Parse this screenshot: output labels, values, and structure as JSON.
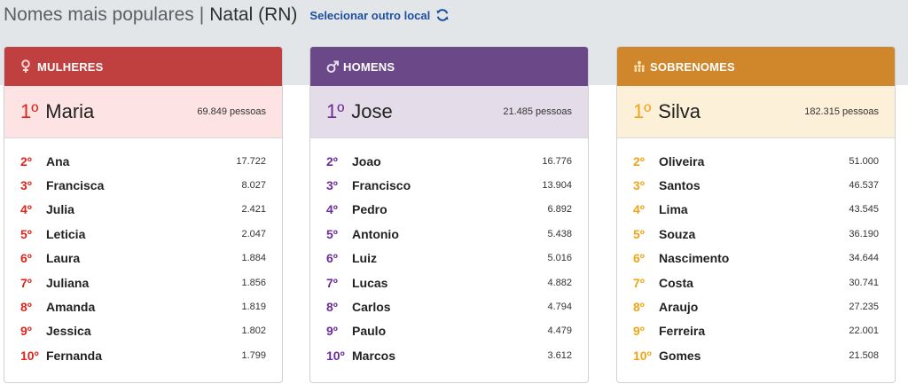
{
  "header": {
    "prefix": "Nomes mais populares",
    "separator": "|",
    "city": "Natal (RN)",
    "change_location_label": "Selecionar outro local",
    "refresh_icon": "refresh-icon"
  },
  "colors": {
    "women": "#c0403f",
    "women_top_bg": "#fde3e4",
    "women_rank": "#e0251a",
    "men": "#6b4887",
    "men_top_bg": "#e4dde9",
    "men_rank": "#6c2c9c",
    "surnames": "#d0862a",
    "surnames_top_bg": "#fdf0d8",
    "surnames_rank": "#f0a416"
  },
  "women": {
    "title": "MULHERES",
    "icon": "female-icon",
    "top": {
      "rank": "1º",
      "name": "Maria",
      "count": "69.849 pessoas"
    },
    "rows": [
      {
        "rank": "2º",
        "name": "Ana",
        "count": "17.722"
      },
      {
        "rank": "3º",
        "name": "Francisca",
        "count": "8.027"
      },
      {
        "rank": "4º",
        "name": "Julia",
        "count": "2.421"
      },
      {
        "rank": "5º",
        "name": "Leticia",
        "count": "2.047"
      },
      {
        "rank": "6º",
        "name": "Laura",
        "count": "1.884"
      },
      {
        "rank": "7º",
        "name": "Juliana",
        "count": "1.856"
      },
      {
        "rank": "8º",
        "name": "Amanda",
        "count": "1.819"
      },
      {
        "rank": "9º",
        "name": "Jessica",
        "count": "1.802"
      },
      {
        "rank": "10º",
        "name": "Fernanda",
        "count": "1.799"
      }
    ]
  },
  "men": {
    "title": "HOMENS",
    "icon": "male-icon",
    "top": {
      "rank": "1º",
      "name": "Jose",
      "count": "21.485 pessoas"
    },
    "rows": [
      {
        "rank": "2º",
        "name": "Joao",
        "count": "16.776"
      },
      {
        "rank": "3º",
        "name": "Francisco",
        "count": "13.904"
      },
      {
        "rank": "4º",
        "name": "Pedro",
        "count": "6.892"
      },
      {
        "rank": "5º",
        "name": "Antonio",
        "count": "5.438"
      },
      {
        "rank": "6º",
        "name": "Luiz",
        "count": "5.016"
      },
      {
        "rank": "7º",
        "name": "Lucas",
        "count": "4.882"
      },
      {
        "rank": "8º",
        "name": "Carlos",
        "count": "4.794"
      },
      {
        "rank": "9º",
        "name": "Paulo",
        "count": "4.479"
      },
      {
        "rank": "10º",
        "name": "Marcos",
        "count": "3.612"
      }
    ]
  },
  "surnames": {
    "title": "SOBRENOMES",
    "icon": "family-icon",
    "top": {
      "rank": "1º",
      "name": "Silva",
      "count": "182.315 pessoas"
    },
    "rows": [
      {
        "rank": "2º",
        "name": "Oliveira",
        "count": "51.000"
      },
      {
        "rank": "3º",
        "name": "Santos",
        "count": "46.537"
      },
      {
        "rank": "4º",
        "name": "Lima",
        "count": "43.545"
      },
      {
        "rank": "5º",
        "name": "Souza",
        "count": "36.190"
      },
      {
        "rank": "6º",
        "name": "Nascimento",
        "count": "34.644"
      },
      {
        "rank": "7º",
        "name": "Costa",
        "count": "30.741"
      },
      {
        "rank": "8º",
        "name": "Araujo",
        "count": "27.235"
      },
      {
        "rank": "9º",
        "name": "Ferreira",
        "count": "22.001"
      },
      {
        "rank": "10º",
        "name": "Gomes",
        "count": "21.508"
      }
    ]
  }
}
